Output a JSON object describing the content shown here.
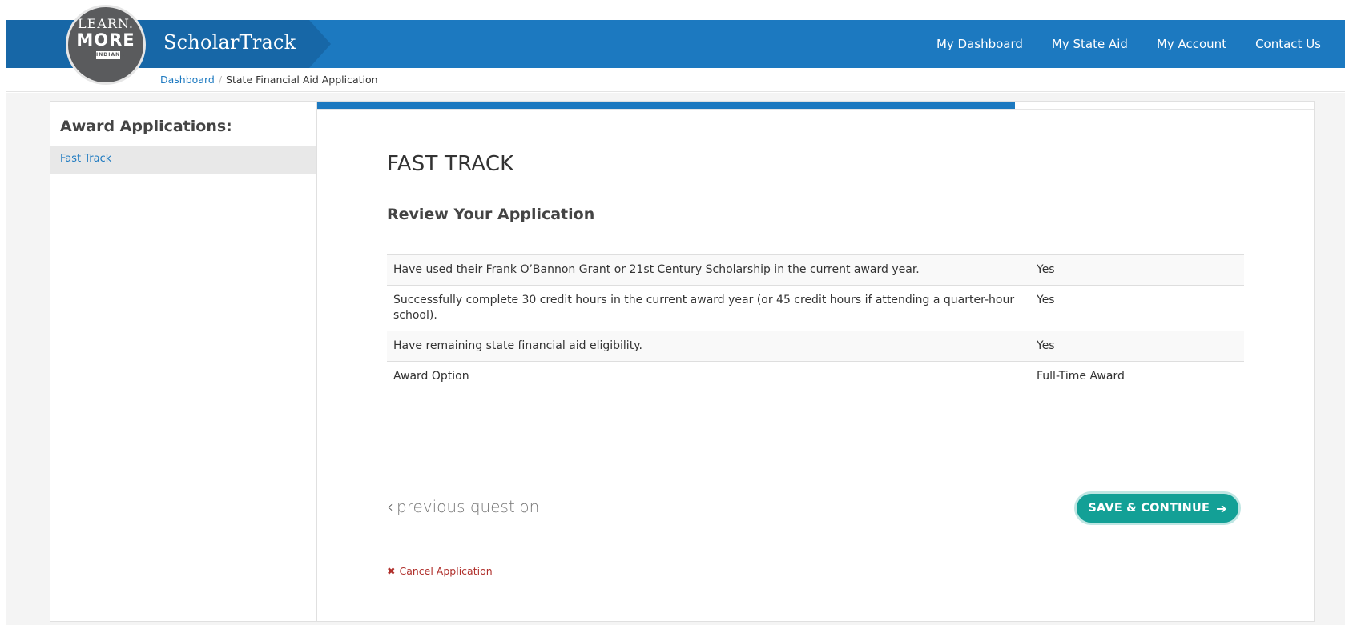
{
  "header": {
    "logo": {
      "line1": "LEARN.",
      "line2": "MORE",
      "line3": "INDIANA"
    },
    "app_title": "ScholarTrack",
    "nav": [
      "My Dashboard",
      "My State Aid",
      "My Account",
      "Contact Us"
    ],
    "colors": {
      "primary": "#1c79c0",
      "accent_dark": "#1767a7"
    }
  },
  "breadcrumb": {
    "items": [
      "Dashboard",
      "State Financial Aid Application"
    ]
  },
  "sidebar": {
    "title": "Award Applications:",
    "items": [
      {
        "label": "Fast Track",
        "active": true
      }
    ]
  },
  "progress": {
    "fraction": 0.7
  },
  "main": {
    "title": "FAST TRACK",
    "subtitle": "Review Your Application",
    "rows": [
      {
        "question": "Have used their Frank O’Bannon Grant or 21st Century Scholarship in the current award year.",
        "answer": "Yes"
      },
      {
        "question": "Successfully complete 30 credit hours in the current award year (or 45 credit hours if attending a quarter-hour school).",
        "answer": "Yes"
      },
      {
        "question": "Have remaining state financial aid eligibility.",
        "answer": "Yes"
      },
      {
        "question": "Award Option",
        "answer": "Full-Time Award"
      }
    ],
    "previous_label": "previous question",
    "save_label": "SAVE & CONTINUE",
    "cancel_label": "Cancel Application",
    "colors": {
      "save_button": "#13a096",
      "cancel": "#b0302c"
    }
  }
}
